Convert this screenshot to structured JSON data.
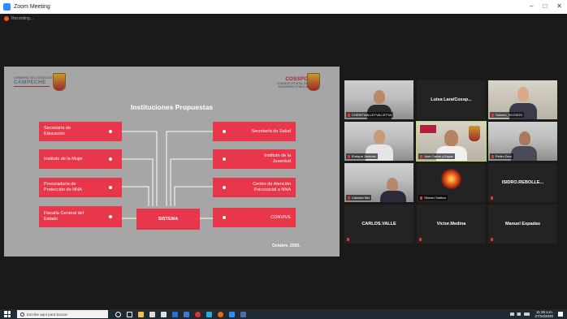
{
  "window": {
    "title": "Zoom Meeting",
    "controls": [
      "–",
      "□",
      "✕"
    ]
  },
  "recording": {
    "label": "Recording..."
  },
  "slide": {
    "logo_left": {
      "gov_text": "GOBIERNO DEL ESTADO DE",
      "name": "CAMPECHE"
    },
    "logo_right": {
      "name": "COSSPO",
      "sub_text": "CONSEJO ESTATAL DE SEGURIDAD PÚBLICA"
    },
    "heading": "Instituciones Propuestas",
    "boxes_left": [
      "Secretaría de Educación",
      "Instituto de la Mujer",
      "Procuraduría de Protección de NNA",
      "Fiscalía General del Estado"
    ],
    "boxes_right": [
      "Secretaría de Salud",
      "Instituto de la Juventud",
      "Centro de Atención Psicosocial a NNA",
      "CONVIVE"
    ],
    "center_box": "SISTEMA",
    "date": "Octubre, 2020."
  },
  "participants": [
    {
      "name": "CHRISTIAN.LEYVA.LETYA",
      "kind": "video"
    },
    {
      "name": "Luisa Lara/Cossp...",
      "kind": "name"
    },
    {
      "name": "Salome_SCGSOS",
      "kind": "video"
    },
    {
      "name": "Enrique Jiménez",
      "kind": "video"
    },
    {
      "name": "José Carlos y Espar",
      "kind": "video"
    },
    {
      "name": "Pedro Dzul",
      "kind": "video"
    },
    {
      "name": "Calzado Mtz",
      "kind": "video"
    },
    {
      "name": "Obeser Sublea",
      "kind": "avatar"
    },
    {
      "name": "ISIDRO.REBOLLE...",
      "kind": "name"
    },
    {
      "name": "CARLOS.VALLE",
      "kind": "name"
    },
    {
      "name": "Víctor.Medina",
      "kind": "name"
    },
    {
      "name": "Manuel Espadas",
      "kind": "name"
    }
  ],
  "taskbar": {
    "search_placeholder": "Escribe aquí para buscar",
    "time": "11:28 a.m.",
    "date": "27/10/2020"
  },
  "colors": {
    "slide_box": "#e8364a",
    "slide_bg": "#a6a6a6",
    "active_speaker": "#b8e05a",
    "background": "#1a1a1a"
  }
}
